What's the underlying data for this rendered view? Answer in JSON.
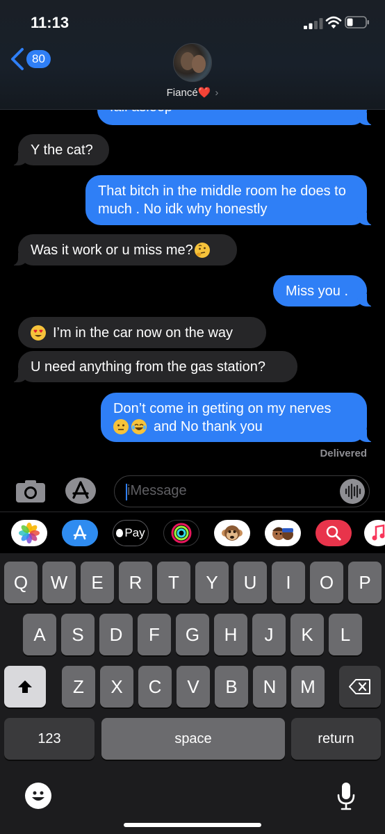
{
  "status_bar": {
    "time": "11:13"
  },
  "header": {
    "back_count": "80",
    "contact_name": "Fiancé",
    "heart": "❤️",
    "chevron": "›"
  },
  "messages": [
    {
      "direction": "out",
      "text": "fall asleep",
      "partial": true
    },
    {
      "direction": "in",
      "text": "Y the cat?"
    },
    {
      "direction": "out",
      "text": "That bitch in the middle room he does to much . No idk why honestly"
    },
    {
      "direction": "in",
      "text": "Was it work or u miss me?",
      "emoji": "thinking-face"
    },
    {
      "direction": "out",
      "text": "Miss you ."
    },
    {
      "direction": "in",
      "text": "I’m in the car now on the way",
      "emoji": "heart-eyes-face"
    },
    {
      "direction": "in",
      "text": "U need anything from the gas station?"
    },
    {
      "direction": "out",
      "text": "Don’t come in getting on my nerves",
      "text2": "and No thank you",
      "emoji": [
        "neutral-face",
        "tears-of-joy-face"
      ]
    }
  ],
  "delivered_label": "Delivered",
  "composer": {
    "placeholder": "iMessage"
  },
  "app_drawer": [
    {
      "icon": "photos-icon"
    },
    {
      "icon": "app-store-icon"
    },
    {
      "icon": "apple-pay-icon",
      "label": "Pay"
    },
    {
      "icon": "activity-icon"
    },
    {
      "icon": "monkey-animoji-icon"
    },
    {
      "icon": "memoji-icon"
    },
    {
      "icon": "web-search-icon"
    },
    {
      "icon": "music-icon"
    }
  ],
  "keyboard": {
    "row1": [
      "Q",
      "W",
      "E",
      "R",
      "T",
      "Y",
      "U",
      "I",
      "O",
      "P"
    ],
    "row2": [
      "A",
      "S",
      "D",
      "F",
      "G",
      "H",
      "J",
      "K",
      "L"
    ],
    "row3": [
      "Z",
      "X",
      "C",
      "V",
      "B",
      "N",
      "M"
    ],
    "numbers_label": "123",
    "space_label": "space",
    "return_label": "return"
  },
  "colors": {
    "outgoing": "#2f7ff6",
    "incoming": "#262628",
    "background": "#000000"
  }
}
